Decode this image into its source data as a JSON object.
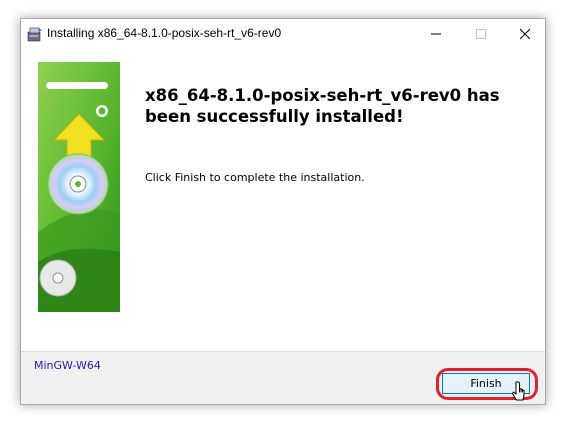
{
  "window": {
    "title": "Installing x86_64-8.1.0-posix-seh-rt_v6-rev0"
  },
  "main": {
    "heading": "x86_64-8.1.0-posix-seh-rt_v6-rev0 has been successfully installed!",
    "message": "Click Finish to complete the installation."
  },
  "footer": {
    "brand": "MinGW-W64",
    "finish_label": "Finish"
  },
  "icons": {
    "app": "installer-icon",
    "minimize": "minimize-icon",
    "maximize": "maximize-icon",
    "close": "close-icon",
    "cursor": "pointer-cursor-icon"
  },
  "colors": {
    "accent": "#0078d7",
    "highlight": "#e0202a",
    "brand_text": "#2020c0",
    "art_green": "#5cb82e"
  }
}
